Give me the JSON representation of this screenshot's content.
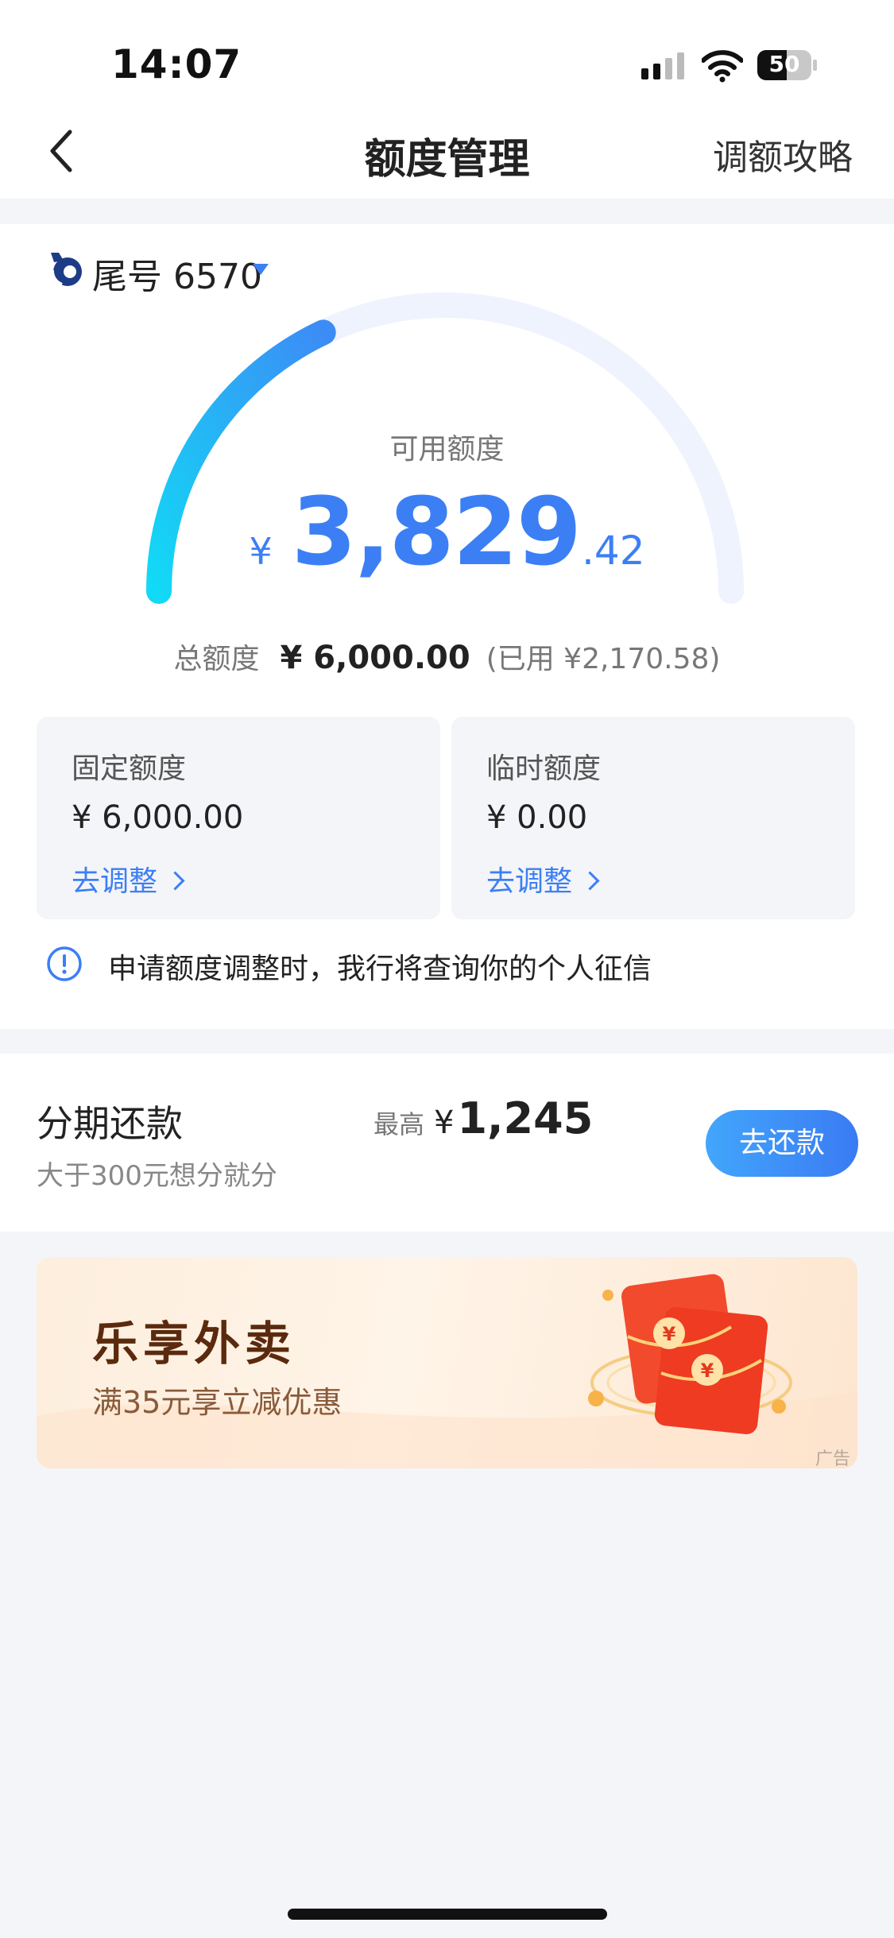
{
  "status_bar": {
    "time": "14:07",
    "battery": "50"
  },
  "nav": {
    "title": "额度管理",
    "right_link": "调额攻略"
  },
  "account": {
    "tail_label": "尾号 6570"
  },
  "credit": {
    "available_label": "可用额度",
    "currency": "¥",
    "available_integer": "3,829",
    "available_decimal": ".42",
    "usage_fraction": 0.36,
    "total_label": "总额度",
    "total_value": "¥ 6,000.00",
    "used_text": "(已用 ¥2,170.58)"
  },
  "quota_boxes": [
    {
      "title": "固定额度",
      "amount": "¥ 6,000.00",
      "link": "去调整"
    },
    {
      "title": "临时额度",
      "amount": "¥ 0.00",
      "link": "去调整"
    }
  ],
  "notice": {
    "text": "申请额度调整时，我行将查询你的个人征信"
  },
  "installment": {
    "title": "分期还款",
    "subtitle": "大于300元想分就分",
    "max_label": "最高",
    "max_currency": "¥",
    "max_value": "1,245",
    "button": "去还款"
  },
  "banner": {
    "title": "乐享外卖",
    "subtitle": "满35元享立减优惠",
    "ad_tag": "广告"
  },
  "colors": {
    "accent": "#3c7ff5",
    "gauge_start": "#12d9f5",
    "gauge_end": "#3c8cf5",
    "gauge_track": "#eef3fd"
  }
}
